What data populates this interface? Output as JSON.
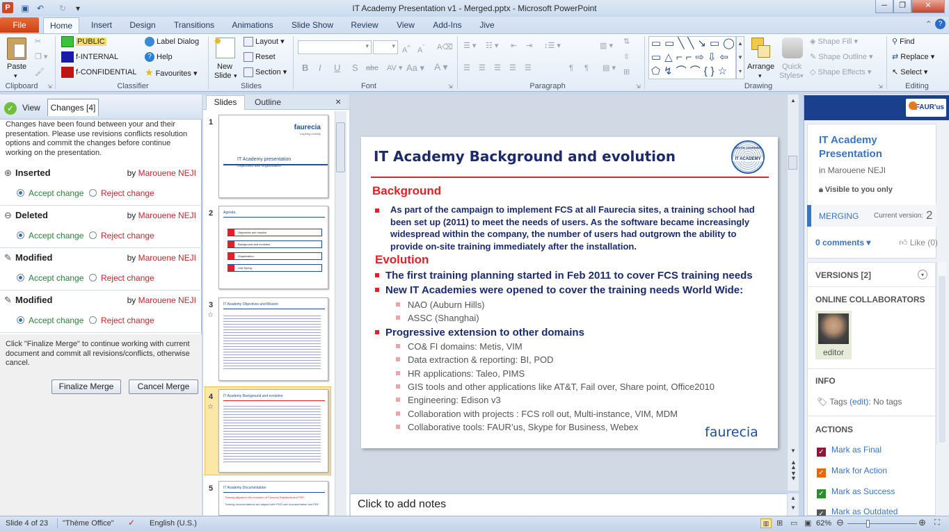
{
  "window": {
    "title": "IT Academy Presentation v1 - Merged.pptx  -  Microsoft PowerPoint"
  },
  "tabs": [
    "File",
    "Home",
    "Insert",
    "Design",
    "Transitions",
    "Animations",
    "Slide Show",
    "Review",
    "View",
    "Add-Ins",
    "Jive"
  ],
  "ribbon": {
    "clipboard": {
      "paste": "Paste",
      "label": "Clipboard"
    },
    "classifier": {
      "public": "PUBLIC",
      "internal": "f-INTERNAL",
      "confidential": "f-CONFIDENTIAL",
      "label_dialog": "Label Dialog",
      "help": "Help",
      "favourites": "Favourites",
      "label": "Classifier",
      "colors": {
        "public": "#3cc13c",
        "internal": "#1a1aa8",
        "confidential": "#c01414"
      }
    },
    "slides": {
      "new_slide": "New",
      "new_slide2": "Slide",
      "layout": "Layout",
      "reset": "Reset",
      "section": "Section",
      "label": "Slides"
    },
    "font": {
      "label": "Font"
    },
    "paragraph": {
      "label": "Paragraph"
    },
    "drawing": {
      "arrange": "Arrange",
      "quick_styles": "Quick",
      "quick_styles2": "Styles",
      "shape_fill": "Shape Fill",
      "shape_outline": "Shape Outline",
      "shape_effects": "Shape Effects",
      "label": "Drawing"
    },
    "editing": {
      "find": "Find",
      "replace": "Replace",
      "select": "Select",
      "label": "Editing"
    }
  },
  "merge_pane": {
    "tab_view": "View",
    "tab_changes": "Changes [4]",
    "message": "Changes have been found between your and their presentation. Please use revisions conflicts resolution options and commit the changes before continue working on the presentation.",
    "changes": [
      {
        "type": "Inserted",
        "by_label": "by",
        "author": "Marouene NEJI",
        "accept": "Accept change",
        "reject": "Reject change"
      },
      {
        "type": "Deleted",
        "by_label": "by",
        "author": "Marouene NEJI",
        "accept": "Accept change",
        "reject": "Reject change"
      },
      {
        "type": "Modified",
        "by_label": "by",
        "author": "Marouene NEJI",
        "accept": "Accept change",
        "reject": "Reject change"
      },
      {
        "type": "Modified",
        "by_label": "by",
        "author": "Marouene NEJI",
        "accept": "Accept change",
        "reject": "Reject change"
      }
    ],
    "footer": "Click \"Finalize Merge\" to continue working with current document and commit all revisions/conflicts, otherwise cancel.",
    "finalize": "Finalize Merge",
    "cancel": "Cancel Merge"
  },
  "slides_pane": {
    "tab_slides": "Slides",
    "tab_outline": "Outline",
    "close": "×",
    "thumbs": [
      {
        "num": "1",
        "title": "IT Academy presentation",
        "subtitle": "Objectives  and  Organization",
        "logo": "faurecia",
        "tagline": "Inspiring mobility"
      },
      {
        "num": "2",
        "title": "Agenda",
        "items": [
          "Objectives and mission",
          "Background and evolution",
          "Organization",
          "Unit Spring"
        ]
      },
      {
        "num": "3",
        "title": "IT Academy  Objectives and Mission"
      },
      {
        "num": "4",
        "title": "IT Academy  Background  and  evolution"
      },
      {
        "num": "5",
        "title": "IT Academy  Documentation",
        "line1": "Training aligned to the evolution of Faurecia Standards and PDF:",
        "line2": "Training  documentations  are aligned with PDS user documentation and PDF"
      }
    ]
  },
  "slide": {
    "title": "IT Academy Background and evolution",
    "badge_top": "DIGITAL LEARNING",
    "badge_mid": "IT ACADEMY",
    "background_heading": "Background",
    "background_text": "As part of the campaign to implement FCS  at all Faurecia sites, a training school had been set up (2011)  to meet the needs of users. As the software became increasingly widespread within the company, the number of users had outgrown the ability to provide on-site training immediately after the installation.",
    "evolution_heading": "Evolution",
    "points": [
      "The first training planning started in Feb 2011  to cover FCS training needs",
      "New IT Academies were opened to cover the training needs World Wide:"
    ],
    "sub1": [
      "NAO  (Auburn Hills)",
      "ASSC  (Shanghai)"
    ],
    "point3": "Progressive extension to other domains",
    "sub2": [
      "CO& FI domains: Metis,  VIM",
      "Data extraction  & reporting: BI, POD",
      "HR applications: Taleo, PIMS",
      "GIS tools and other applications like AT&T,  Fail over, Share  point, Office2010",
      "Engineering:  Edison v3",
      "Collaboration with projects : FCS roll out, Multi-instance, VIM,  MDM",
      "Collaborative tools: FAUR’us, Skype  for Business,  Webex"
    ],
    "logo": "faurecia"
  },
  "notes": {
    "placeholder": "Click to add notes"
  },
  "jive": {
    "brand": "FAUR'us",
    "title": "IT Academy Presentation",
    "in_label": "in",
    "owner": "Marouene NEJI",
    "visibility": "Visible to you only",
    "state": "MERGING",
    "current_version_label": "Current version:",
    "current_version": "2",
    "comments": "0 comments",
    "like": "Like (0)",
    "versions": "VERSIONS [2]",
    "collab_heading": "ONLINE COLLABORATORS",
    "collab_role": "editor",
    "info_heading": "INFO",
    "tags_label": "Tags",
    "tags_edit": "(edit)",
    "tags_value": ": No tags",
    "actions_heading": "ACTIONS",
    "actions": [
      {
        "label": "Mark as Final",
        "color": "#8b1a3a"
      },
      {
        "label": "Mark for Action",
        "color": "#e06a10"
      },
      {
        "label": "Mark as Success",
        "color": "#2e8b2e"
      },
      {
        "label": "Mark as Outdated",
        "color": "#555555"
      }
    ]
  },
  "status": {
    "slide": "Slide 4 of 23",
    "theme": "\"Thème Office\"",
    "language": "English (U.S.)",
    "zoom": "62%"
  }
}
